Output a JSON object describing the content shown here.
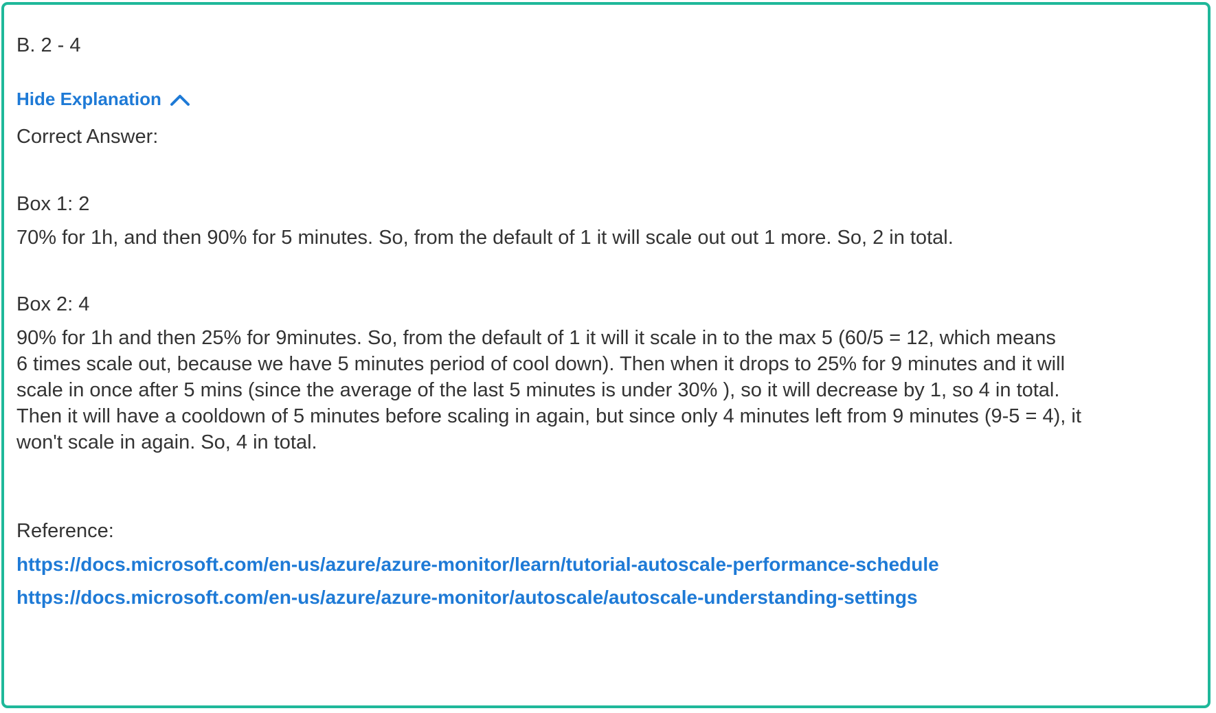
{
  "answer_option": "B. 2 - 4",
  "toggle": {
    "label": "Hide Explanation",
    "icon": "chevron-up-icon"
  },
  "explanation": {
    "correct_answer_label": "Correct Answer:",
    "box1": {
      "title": "Box 1: 2",
      "text": "70% for 1h, and then 90% for 5 minutes. So, from the default of 1 it will scale out out 1 more. So, 2 in total."
    },
    "box2": {
      "title": "Box 2: 4",
      "lines": [
        "90% for 1h and then 25% for 9minutes. So, from the default of 1 it will it scale in to the max 5 (60/5 = 12, which means",
        "6 times scale out, because we have 5 minutes period of cool down). Then when it drops to 25% for 9 minutes and it will",
        "scale in once after 5 mins (since the average of the last 5 minutes is under 30% ), so it will decrease by 1, so 4 in total.",
        "Then it will have a cooldown of 5 minutes before scaling in again, but since only 4 minutes left from 9 minutes (9-5 = 4), it",
        "won't scale in again. So, 4 in total."
      ]
    },
    "reference_label": "Reference:",
    "links": [
      "https://docs.microsoft.com/en-us/azure/azure-monitor/learn/tutorial-autoscale-performance-schedule",
      "https://docs.microsoft.com/en-us/azure/azure-monitor/autoscale/autoscale-understanding-settings"
    ]
  },
  "colors": {
    "border": "#1fb89a",
    "link": "#1e7ad6",
    "text": "#333333"
  }
}
